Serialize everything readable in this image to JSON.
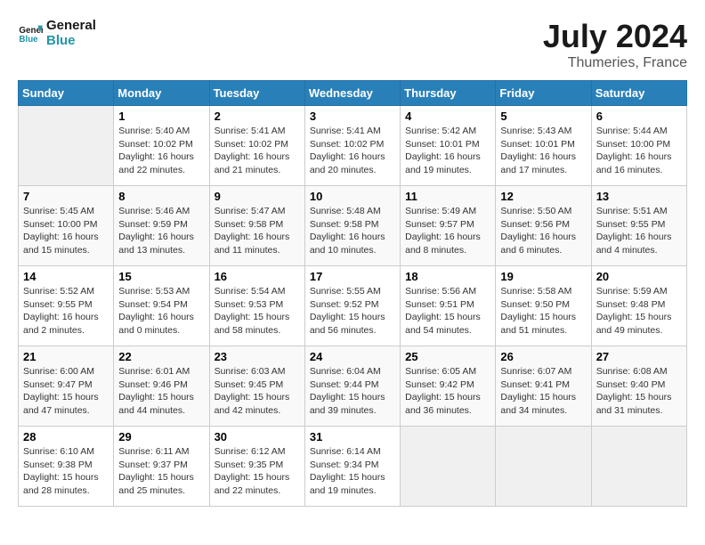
{
  "header": {
    "logo_line1": "General",
    "logo_line2": "Blue",
    "month": "July 2024",
    "location": "Thumeries, France"
  },
  "days_of_week": [
    "Sunday",
    "Monday",
    "Tuesday",
    "Wednesday",
    "Thursday",
    "Friday",
    "Saturday"
  ],
  "weeks": [
    [
      {
        "day": "",
        "info": ""
      },
      {
        "day": "1",
        "info": "Sunrise: 5:40 AM\nSunset: 10:02 PM\nDaylight: 16 hours\nand 22 minutes."
      },
      {
        "day": "2",
        "info": "Sunrise: 5:41 AM\nSunset: 10:02 PM\nDaylight: 16 hours\nand 21 minutes."
      },
      {
        "day": "3",
        "info": "Sunrise: 5:41 AM\nSunset: 10:02 PM\nDaylight: 16 hours\nand 20 minutes."
      },
      {
        "day": "4",
        "info": "Sunrise: 5:42 AM\nSunset: 10:01 PM\nDaylight: 16 hours\nand 19 minutes."
      },
      {
        "day": "5",
        "info": "Sunrise: 5:43 AM\nSunset: 10:01 PM\nDaylight: 16 hours\nand 17 minutes."
      },
      {
        "day": "6",
        "info": "Sunrise: 5:44 AM\nSunset: 10:00 PM\nDaylight: 16 hours\nand 16 minutes."
      }
    ],
    [
      {
        "day": "7",
        "info": "Sunrise: 5:45 AM\nSunset: 10:00 PM\nDaylight: 16 hours\nand 15 minutes."
      },
      {
        "day": "8",
        "info": "Sunrise: 5:46 AM\nSunset: 9:59 PM\nDaylight: 16 hours\nand 13 minutes."
      },
      {
        "day": "9",
        "info": "Sunrise: 5:47 AM\nSunset: 9:58 PM\nDaylight: 16 hours\nand 11 minutes."
      },
      {
        "day": "10",
        "info": "Sunrise: 5:48 AM\nSunset: 9:58 PM\nDaylight: 16 hours\nand 10 minutes."
      },
      {
        "day": "11",
        "info": "Sunrise: 5:49 AM\nSunset: 9:57 PM\nDaylight: 16 hours\nand 8 minutes."
      },
      {
        "day": "12",
        "info": "Sunrise: 5:50 AM\nSunset: 9:56 PM\nDaylight: 16 hours\nand 6 minutes."
      },
      {
        "day": "13",
        "info": "Sunrise: 5:51 AM\nSunset: 9:55 PM\nDaylight: 16 hours\nand 4 minutes."
      }
    ],
    [
      {
        "day": "14",
        "info": "Sunrise: 5:52 AM\nSunset: 9:55 PM\nDaylight: 16 hours\nand 2 minutes."
      },
      {
        "day": "15",
        "info": "Sunrise: 5:53 AM\nSunset: 9:54 PM\nDaylight: 16 hours\nand 0 minutes."
      },
      {
        "day": "16",
        "info": "Sunrise: 5:54 AM\nSunset: 9:53 PM\nDaylight: 15 hours\nand 58 minutes."
      },
      {
        "day": "17",
        "info": "Sunrise: 5:55 AM\nSunset: 9:52 PM\nDaylight: 15 hours\nand 56 minutes."
      },
      {
        "day": "18",
        "info": "Sunrise: 5:56 AM\nSunset: 9:51 PM\nDaylight: 15 hours\nand 54 minutes."
      },
      {
        "day": "19",
        "info": "Sunrise: 5:58 AM\nSunset: 9:50 PM\nDaylight: 15 hours\nand 51 minutes."
      },
      {
        "day": "20",
        "info": "Sunrise: 5:59 AM\nSunset: 9:48 PM\nDaylight: 15 hours\nand 49 minutes."
      }
    ],
    [
      {
        "day": "21",
        "info": "Sunrise: 6:00 AM\nSunset: 9:47 PM\nDaylight: 15 hours\nand 47 minutes."
      },
      {
        "day": "22",
        "info": "Sunrise: 6:01 AM\nSunset: 9:46 PM\nDaylight: 15 hours\nand 44 minutes."
      },
      {
        "day": "23",
        "info": "Sunrise: 6:03 AM\nSunset: 9:45 PM\nDaylight: 15 hours\nand 42 minutes."
      },
      {
        "day": "24",
        "info": "Sunrise: 6:04 AM\nSunset: 9:44 PM\nDaylight: 15 hours\nand 39 minutes."
      },
      {
        "day": "25",
        "info": "Sunrise: 6:05 AM\nSunset: 9:42 PM\nDaylight: 15 hours\nand 36 minutes."
      },
      {
        "day": "26",
        "info": "Sunrise: 6:07 AM\nSunset: 9:41 PM\nDaylight: 15 hours\nand 34 minutes."
      },
      {
        "day": "27",
        "info": "Sunrise: 6:08 AM\nSunset: 9:40 PM\nDaylight: 15 hours\nand 31 minutes."
      }
    ],
    [
      {
        "day": "28",
        "info": "Sunrise: 6:10 AM\nSunset: 9:38 PM\nDaylight: 15 hours\nand 28 minutes."
      },
      {
        "day": "29",
        "info": "Sunrise: 6:11 AM\nSunset: 9:37 PM\nDaylight: 15 hours\nand 25 minutes."
      },
      {
        "day": "30",
        "info": "Sunrise: 6:12 AM\nSunset: 9:35 PM\nDaylight: 15 hours\nand 22 minutes."
      },
      {
        "day": "31",
        "info": "Sunrise: 6:14 AM\nSunset: 9:34 PM\nDaylight: 15 hours\nand 19 minutes."
      },
      {
        "day": "",
        "info": ""
      },
      {
        "day": "",
        "info": ""
      },
      {
        "day": "",
        "info": ""
      }
    ]
  ]
}
